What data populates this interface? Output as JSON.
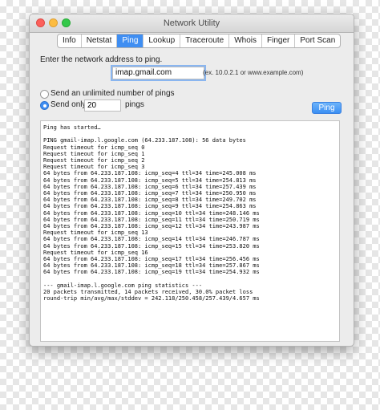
{
  "window": {
    "title": "Network Utility"
  },
  "tabs": [
    "Info",
    "Netstat",
    "Ping",
    "Lookup",
    "Traceroute",
    "Whois",
    "Finger",
    "Port Scan"
  ],
  "active_tab": "Ping",
  "ping": {
    "prompt": "Enter the network address to ping.",
    "address": "imap.gmail.com",
    "address_hint": "(ex. 10.0.2.1 or www.example.com)",
    "option_unlimited": "Send an unlimited number of pings",
    "option_send_only": "Send only",
    "count": "20",
    "count_suffix": "pings",
    "button_label": "Ping",
    "selected_option": "send_only"
  },
  "output": {
    "lines": [
      "Ping has started…",
      "",
      "PING gmail-imap.l.google.com (64.233.187.108): 56 data bytes",
      "Request timeout for icmp_seq 0",
      "Request timeout for icmp_seq 1",
      "Request timeout for icmp_seq 2",
      "Request timeout for icmp_seq 3",
      "64 bytes from 64.233.187.108: icmp_seq=4 ttl=34 time=245.008 ms",
      "64 bytes from 64.233.187.108: icmp_seq=5 ttl=34 time=254.813 ms",
      "64 bytes from 64.233.187.108: icmp_seq=6 ttl=34 time=257.439 ms",
      "64 bytes from 64.233.187.108: icmp_seq=7 ttl=34 time=250.950 ms",
      "64 bytes from 64.233.187.108: icmp_seq=8 ttl=34 time=249.702 ms",
      "64 bytes from 64.233.187.108: icmp_seq=9 ttl=34 time=254.863 ms",
      "64 bytes from 64.233.187.108: icmp_seq=10 ttl=34 time=248.146 ms",
      "64 bytes from 64.233.187.108: icmp_seq=11 ttl=34 time=250.719 ms",
      "64 bytes from 64.233.187.108: icmp_seq=12 ttl=34 time=243.987 ms",
      "Request timeout for icmp_seq 13",
      "64 bytes from 64.233.187.108: icmp_seq=14 ttl=34 time=246.787 ms",
      "64 bytes from 64.233.187.108: icmp_seq=15 ttl=34 time=253.820 ms",
      "Request timeout for icmp_seq 16",
      "64 bytes from 64.233.187.108: icmp_seq=17 ttl=34 time=256.456 ms",
      "64 bytes from 64.233.187.108: icmp_seq=18 ttl=34 time=257.867 ms",
      "64 bytes from 64.233.187.108: icmp_seq=19 ttl=34 time=254.932 ms",
      "",
      "--- gmail-imap.l.google.com ping statistics ---",
      "20 packets transmitted, 14 packets received, 30.0% packet loss",
      "round-trip min/avg/max/stddev = 242.118/250.458/257.439/4.657 ms"
    ]
  },
  "colors": {
    "accent": "#3f8ef2",
    "close": "#fc605b",
    "minimize": "#fdbc40",
    "maximize": "#34c84a"
  }
}
